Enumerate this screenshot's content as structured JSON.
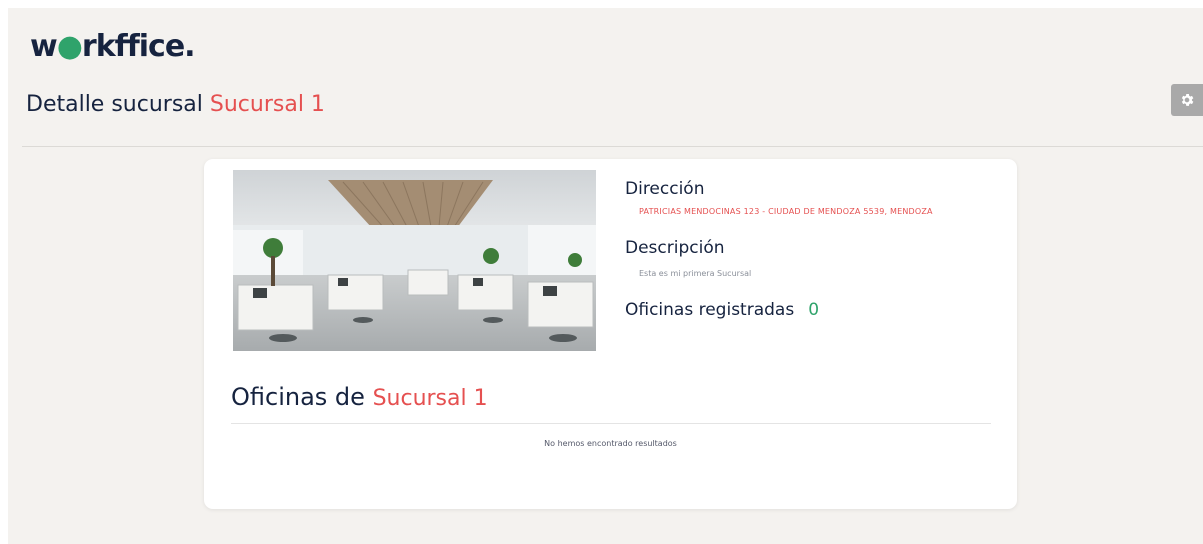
{
  "brand": {
    "logo_pre": "w",
    "logo_dot": "●",
    "logo_post": "rkffice.",
    "accent": "#e55050",
    "green": "#2fa36b"
  },
  "header": {
    "title_prefix": "Detalle sucursal",
    "branch_name": "Sucursal 1"
  },
  "toolbar": {
    "settings_icon": "gear-icon"
  },
  "branch": {
    "address_label": "Dirección",
    "address": "PATRICIAS MENDOCINAS 123 - CIUDAD DE MENDOZA 5539, MENDOZA",
    "description_label": "Descripción",
    "description": "Esta es mi primera Sucursal",
    "offices_label": "Oficinas registradas",
    "offices_count": "0"
  },
  "offices": {
    "title_prefix": "Oficinas de",
    "branch_name": "Sucursal 1",
    "empty_message": "No hemos encontrado resultados"
  }
}
